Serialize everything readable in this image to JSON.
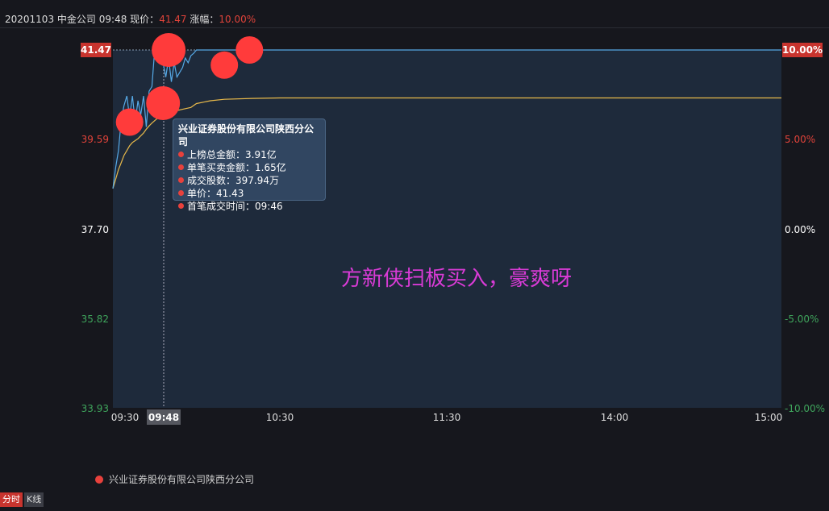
{
  "header": {
    "date": "20201103",
    "stock": "中金公司",
    "time": "09:48",
    "price_label": "现价：",
    "price": "41.47",
    "change_label": "涨幅：",
    "change": "10.00%"
  },
  "colors": {
    "price_line": "#56a9e6",
    "avg_line": "#e8b94a",
    "up": "#e0433a",
    "down": "#3fa55c",
    "bubble": "#ff3b3b",
    "annotation": "#d93bd6"
  },
  "chart_data": {
    "type": "line",
    "x_ticks": [
      "09:30",
      "10:30",
      "11:30",
      "14:00",
      "15:00"
    ],
    "crosshair": {
      "time": "09:48",
      "price": "41.47",
      "pct": "10.00%"
    },
    "y_left_ticks": [
      "39.59",
      "37.70",
      "35.82",
      "33.93"
    ],
    "y_right_ticks": [
      "5.00%",
      "0.00%",
      "-5.00%",
      "-10.00%"
    ],
    "ylim": [
      33.93,
      41.47
    ],
    "series": [
      {
        "x_minutes": [
          0,
          1,
          2,
          3,
          4,
          5,
          6,
          7,
          8,
          9,
          10,
          11,
          12,
          13,
          14,
          15,
          16,
          17,
          18,
          19,
          20,
          21,
          22,
          23,
          24,
          25,
          26,
          27,
          28,
          29,
          30,
          31,
          32,
          33,
          34,
          35,
          36,
          37,
          38,
          240
        ],
        "values": [
          38.55,
          39.0,
          39.35,
          40.0,
          40.3,
          40.5,
          40.05,
          40.5,
          39.95,
          40.4,
          40.1,
          40.5,
          39.85,
          40.6,
          40.7,
          41.47,
          41.47,
          41.47,
          41.2,
          40.9,
          41.3,
          40.8,
          41.2,
          40.9,
          41.0,
          41.1,
          41.3,
          41.2,
          41.35,
          41.4,
          41.47,
          41.47,
          41.47,
          41.47,
          41.47,
          41.47,
          41.47,
          41.47,
          41.47,
          41.47
        ]
      },
      {
        "x_minutes": [
          0,
          1,
          2,
          3,
          4,
          5,
          6,
          7,
          8,
          9,
          10,
          11,
          12,
          13,
          14,
          15,
          16,
          17,
          18,
          20,
          22,
          25,
          28,
          30,
          35,
          40,
          50,
          60,
          240
        ],
        "values": [
          38.55,
          38.75,
          38.95,
          39.1,
          39.25,
          39.35,
          39.45,
          39.52,
          39.56,
          39.6,
          39.66,
          39.72,
          39.8,
          39.87,
          39.93,
          39.98,
          40.03,
          40.07,
          40.1,
          40.14,
          40.18,
          40.22,
          40.26,
          40.34,
          40.4,
          40.43,
          40.45,
          40.46,
          40.46
        ]
      }
    ],
    "bubbles": [
      {
        "minute": 6,
        "price": 39.95,
        "size": "medium"
      },
      {
        "minute": 18,
        "price": 40.35,
        "size": "large"
      },
      {
        "minute": 20,
        "price": 41.47,
        "size": "large"
      },
      {
        "minute": 40,
        "price": 41.15,
        "size": "medium"
      },
      {
        "minute": 49,
        "price": 41.47,
        "size": "medium"
      }
    ]
  },
  "tooltip": {
    "title": "兴业证券股份有限公司陕西分公司",
    "rows": [
      "上榜总金额：3.91亿",
      "单笔买卖金额：1.65亿",
      "成交股数：397.94万",
      "单价：41.43",
      "首笔成交时间：09:46"
    ]
  },
  "annotation": "方新侠扫板买入，豪爽呀",
  "legend": {
    "label": "兴业证券股份有限公司陕西分公司"
  },
  "tabs": [
    {
      "label": "分时"
    },
    {
      "label": "K线"
    }
  ]
}
